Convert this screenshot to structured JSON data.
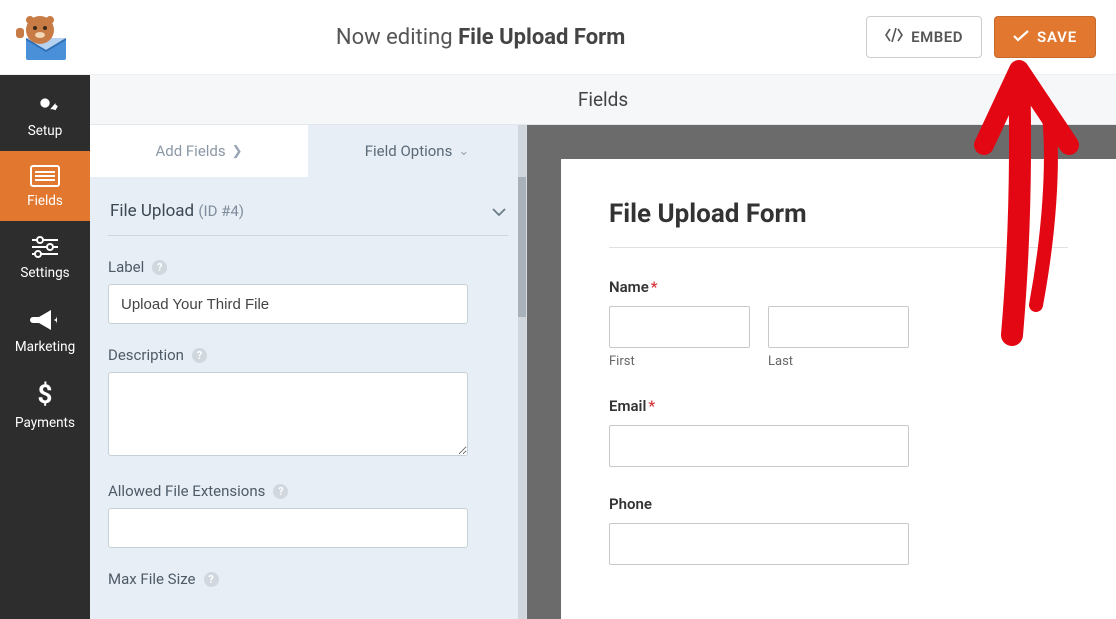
{
  "header": {
    "editing_prefix": "Now editing",
    "form_name": "File Upload Form",
    "embed_label": "EMBED",
    "save_label": "SAVE"
  },
  "sidebar": {
    "items": [
      {
        "label": "Setup"
      },
      {
        "label": "Fields"
      },
      {
        "label": "Settings"
      },
      {
        "label": "Marketing"
      },
      {
        "label": "Payments"
      }
    ]
  },
  "section_title": "Fields",
  "tabs": {
    "add_fields": "Add Fields",
    "field_options": "Field Options"
  },
  "field_options": {
    "name": "File Upload",
    "id_text": "(ID #4)",
    "label_label": "Label",
    "label_value": "Upload Your Third File",
    "description_label": "Description",
    "description_value": "",
    "allowed_ext_label": "Allowed File Extensions",
    "allowed_ext_value": "",
    "max_size_label": "Max File Size"
  },
  "preview": {
    "form_title": "File Upload Form",
    "name_label": "Name",
    "first_sub": "First",
    "last_sub": "Last",
    "email_label": "Email",
    "phone_label": "Phone",
    "required_marker": "*"
  }
}
